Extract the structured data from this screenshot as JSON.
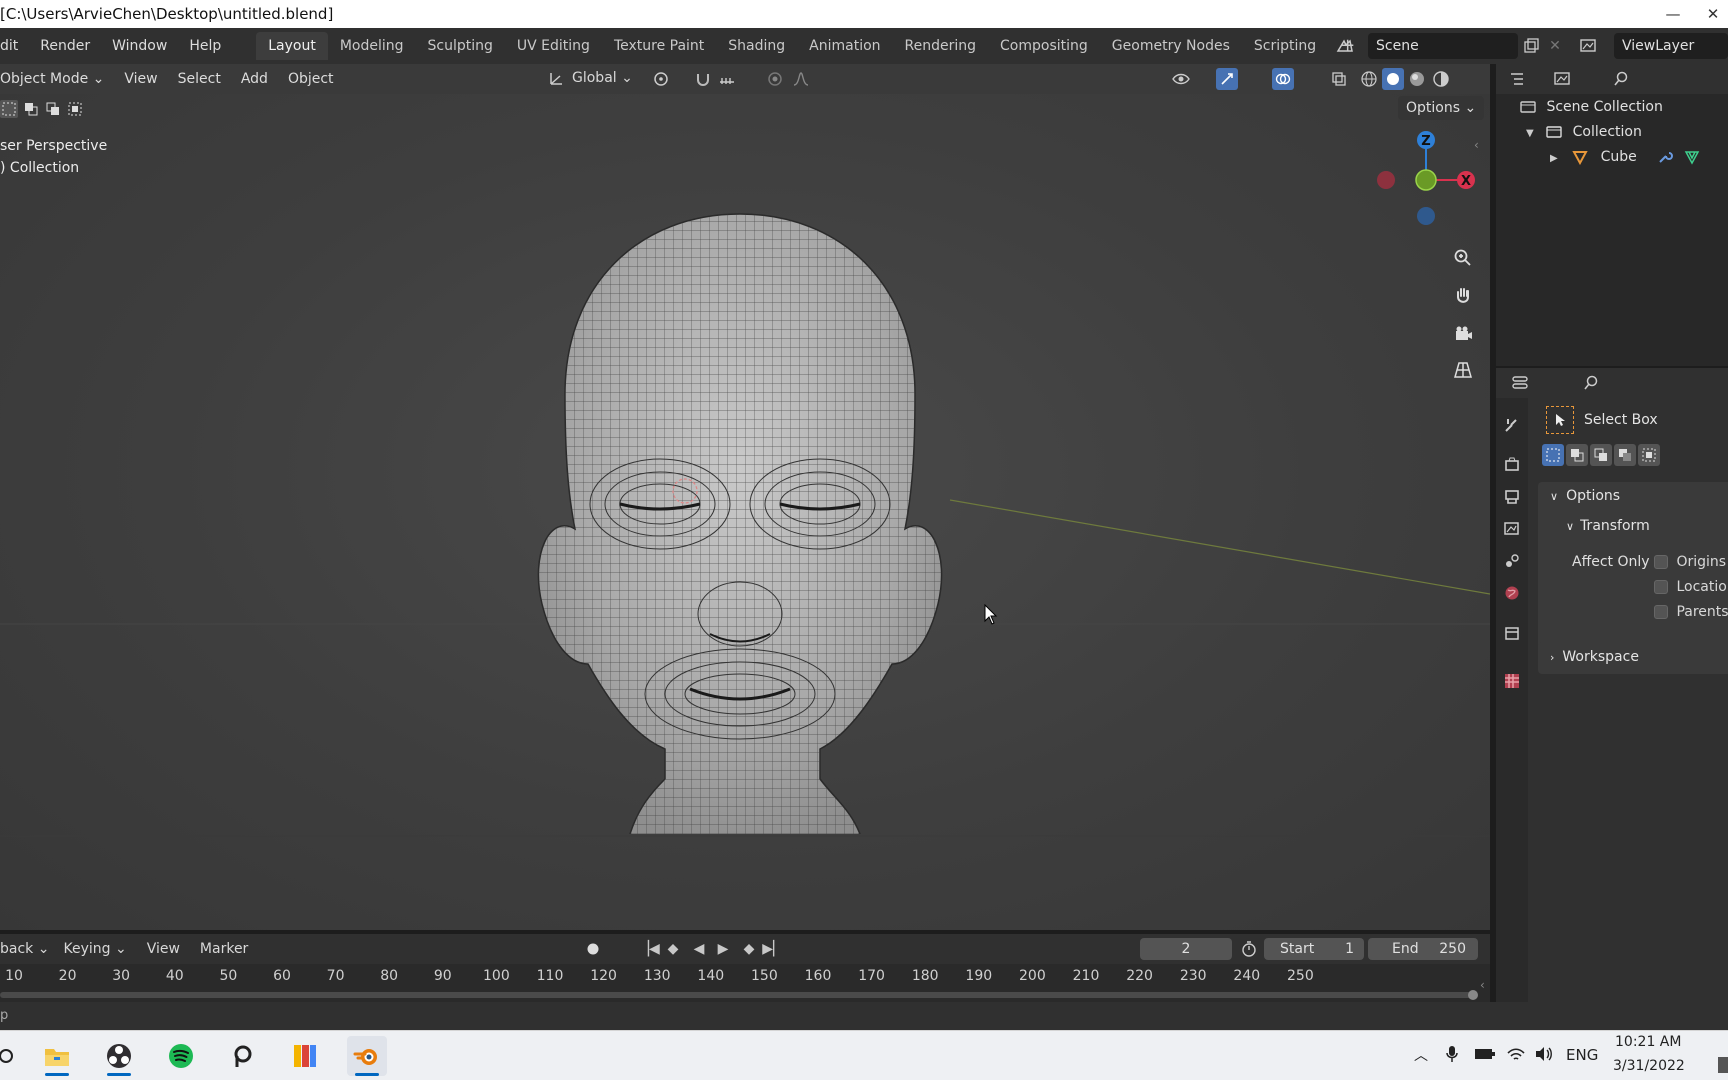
{
  "window": {
    "title": "[C:\\Users\\ArvieChen\\Desktop\\untitled.blend]",
    "minimize": "—",
    "close": "✕"
  },
  "menu": [
    "dit",
    "Render",
    "Window",
    "Help"
  ],
  "workspaces": [
    "Layout",
    "Modeling",
    "Sculpting",
    "UV Editing",
    "Texture Paint",
    "Shading",
    "Animation",
    "Rendering",
    "Compositing",
    "Geometry Nodes",
    "Scripting"
  ],
  "add_workspace": "+",
  "scene": {
    "name": "Scene",
    "viewlayer": "ViewLayer"
  },
  "viewport_header": {
    "mode": "Object Mode",
    "menus": [
      "View",
      "Select",
      "Add",
      "Object"
    ],
    "orientation": "Global"
  },
  "viewport": {
    "options_label": "Options",
    "overlay_line1": "ser Perspective",
    "overlay_line2": ") Collection",
    "gizmo": {
      "z": "Z",
      "x": "X"
    }
  },
  "outliner": {
    "scene_collection": "Scene Collection",
    "collection": "Collection",
    "cube": "Cube"
  },
  "properties": {
    "tool_name": "Select Box",
    "options_panel": "Options",
    "transform_panel": "Transform",
    "affect_only": "Affect Only",
    "checks": [
      "Origins",
      "Location",
      "Parents"
    ],
    "workspace_panel": "Workspace"
  },
  "timeline": {
    "menus": [
      "back",
      "Keying",
      "View",
      "Marker"
    ],
    "current_frame": "2",
    "start_label": "Start",
    "start_value": "1",
    "end_label": "End",
    "end_value": "250",
    "ruler": [
      "10",
      "20",
      "30",
      "40",
      "50",
      "60",
      "70",
      "80",
      "90",
      "100",
      "110",
      "120",
      "130",
      "140",
      "150",
      "160",
      "170",
      "180",
      "190",
      "200",
      "210",
      "220",
      "230",
      "240",
      "250"
    ]
  },
  "statusbar": {
    "text": "p"
  },
  "taskbar": {
    "lang": "ENG",
    "time": "10:21 AM",
    "date": "3/31/2022"
  }
}
